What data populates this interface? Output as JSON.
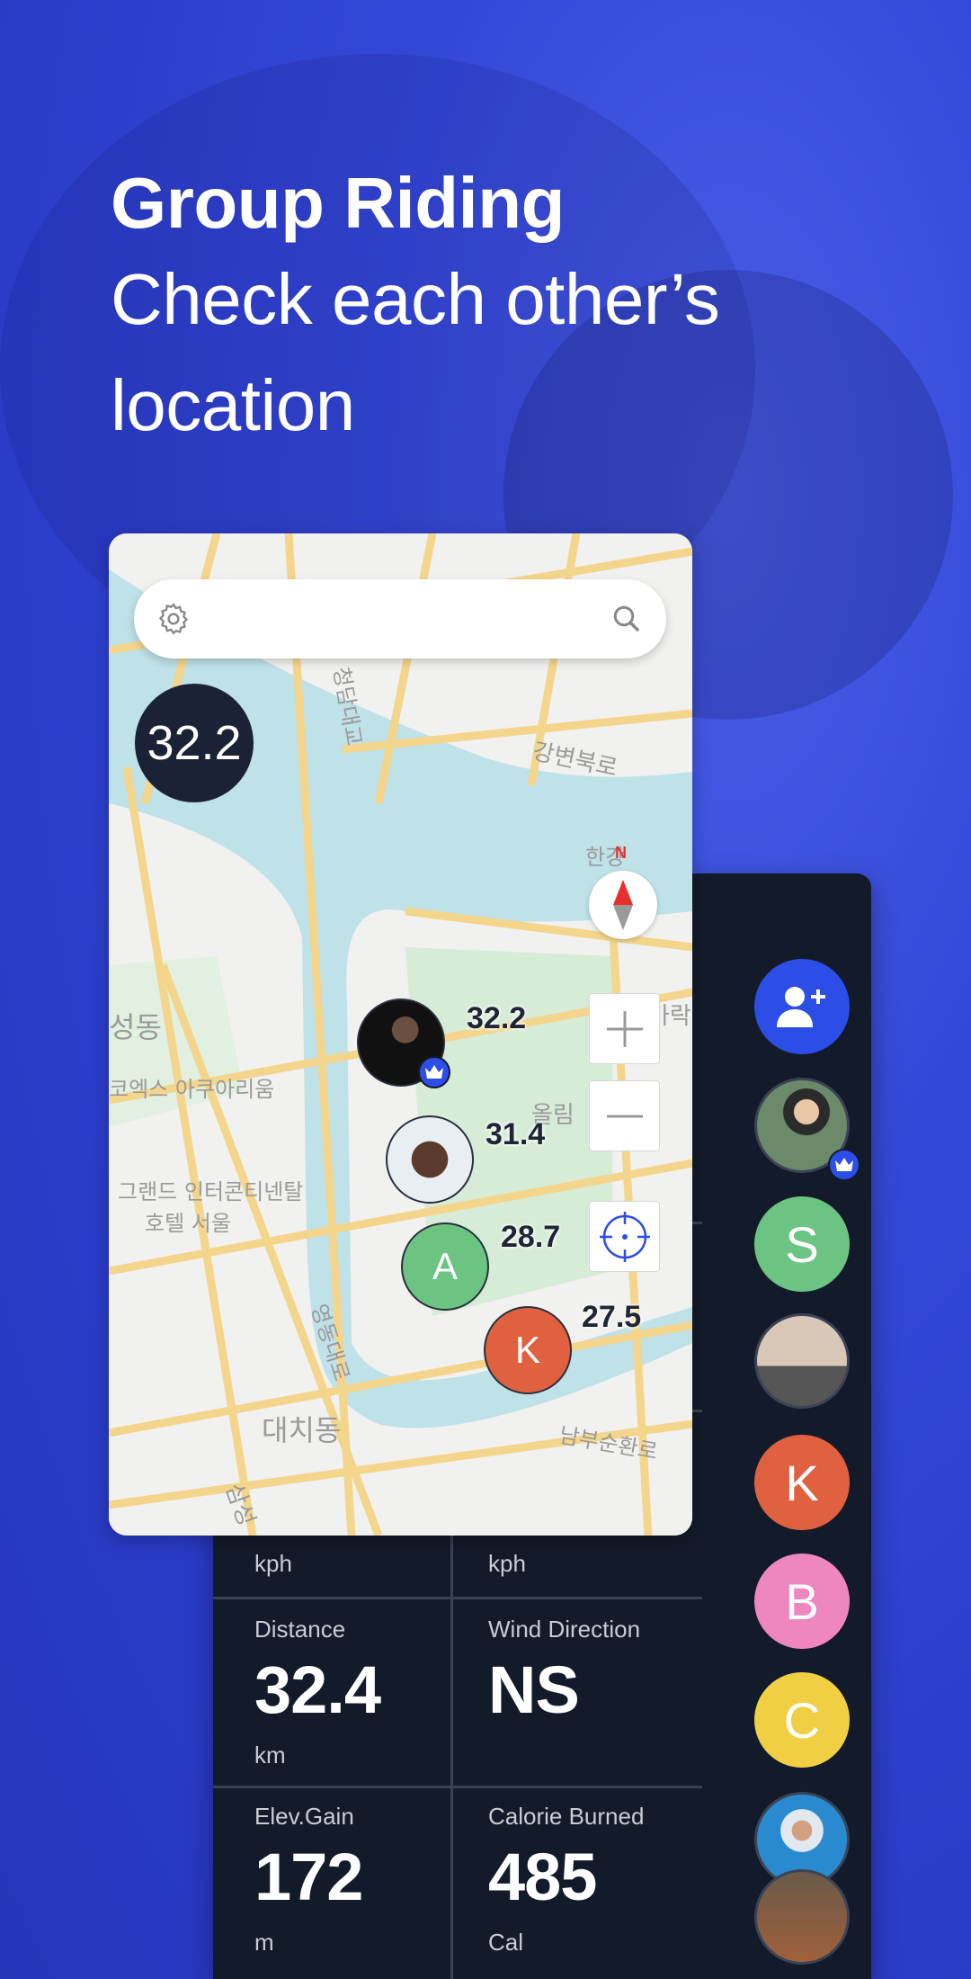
{
  "headline": {
    "title": "Group Riding",
    "subtitle_line1": "Check each other’s",
    "subtitle_line2": "location"
  },
  "map": {
    "search_placeholder": "",
    "current_speed": "32.2",
    "compass_label": "N",
    "icons": {
      "settings": "gear-icon",
      "search": "search-icon",
      "zoom_in": "plus-icon",
      "zoom_out": "minus-icon",
      "locate": "crosshair-icon",
      "compass": "compass-icon"
    },
    "place_labels": [
      "강변북로",
      "청담대교",
      "한강",
      "성동",
      "코엑스 아쿠아리움",
      "그랜드 인터콘티넨탈 호텔 서울",
      "영동대로",
      "올림",
      "대치동",
      "남부순환로",
      "삼성",
      "가락"
    ],
    "riders": [
      {
        "type": "photo",
        "speed": "32.2",
        "leader": true
      },
      {
        "type": "photo",
        "speed": "31.4",
        "leader": false
      },
      {
        "type": "initial",
        "initial": "A",
        "speed": "28.7",
        "color": "#6cc483"
      },
      {
        "type": "initial",
        "initial": "K",
        "speed": "27.5",
        "color": "#e0613f"
      }
    ]
  },
  "stats": {
    "top_units": [
      "kph",
      "kph"
    ],
    "cells": [
      {
        "label": "Distance",
        "value": "32.4",
        "unit": "km"
      },
      {
        "label": "Wind Direction",
        "value": "NS",
        "unit": ""
      },
      {
        "label": "Elev.Gain",
        "value": "172",
        "unit": "m"
      },
      {
        "label": "Calorie Burned",
        "value": "485",
        "unit": "Cal"
      }
    ]
  },
  "members": [
    {
      "type": "add",
      "icon": "add-user-icon",
      "color": "#2c4de6"
    },
    {
      "type": "photo",
      "leader": true
    },
    {
      "type": "initial",
      "initial": "S",
      "color": "#6cc483"
    },
    {
      "type": "photo",
      "leader": false
    },
    {
      "type": "initial",
      "initial": "K",
      "color": "#e0613f"
    },
    {
      "type": "initial",
      "initial": "B",
      "color": "#ee86bf"
    },
    {
      "type": "initial",
      "initial": "C",
      "color": "#f0cf45"
    },
    {
      "type": "photo",
      "leader": false
    },
    {
      "type": "photo",
      "leader": false
    }
  ],
  "colors": {
    "background": "#3448d8",
    "panel": "#131a2a",
    "accent": "#2c4de6"
  }
}
